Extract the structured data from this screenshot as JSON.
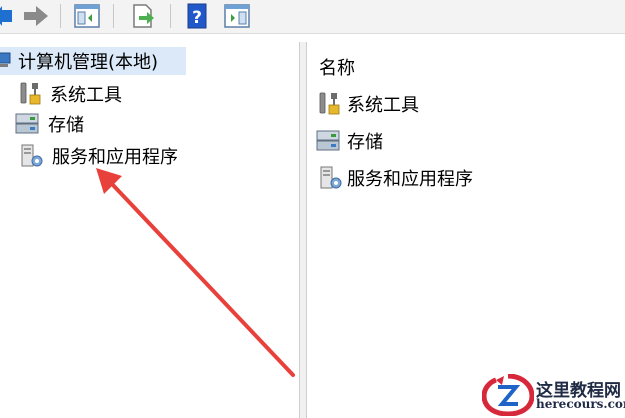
{
  "toolbar": {
    "buttons": [
      "back-arrow-icon",
      "forward-arrow-icon",
      "show-hide-tree-icon",
      "export-list-icon",
      "help-icon",
      "show-hide-action-pane-icon"
    ]
  },
  "tree": {
    "root_label": "计算机管理(本地)",
    "items": [
      {
        "label": "系统工具",
        "icon": "tools-icon"
      },
      {
        "label": "存储",
        "icon": "storage-icon"
      },
      {
        "label": "服务和应用程序",
        "icon": "services-icon"
      }
    ]
  },
  "list": {
    "column_header": "名称",
    "items": [
      {
        "label": "系统工具",
        "icon": "tools-icon"
      },
      {
        "label": "存储",
        "icon": "storage-icon"
      },
      {
        "label": "服务和应用程序",
        "icon": "services-icon"
      }
    ]
  },
  "annotation": {
    "color": "#e8403a"
  },
  "watermark": {
    "title": "这里教程网",
    "url": "herecours.com"
  }
}
